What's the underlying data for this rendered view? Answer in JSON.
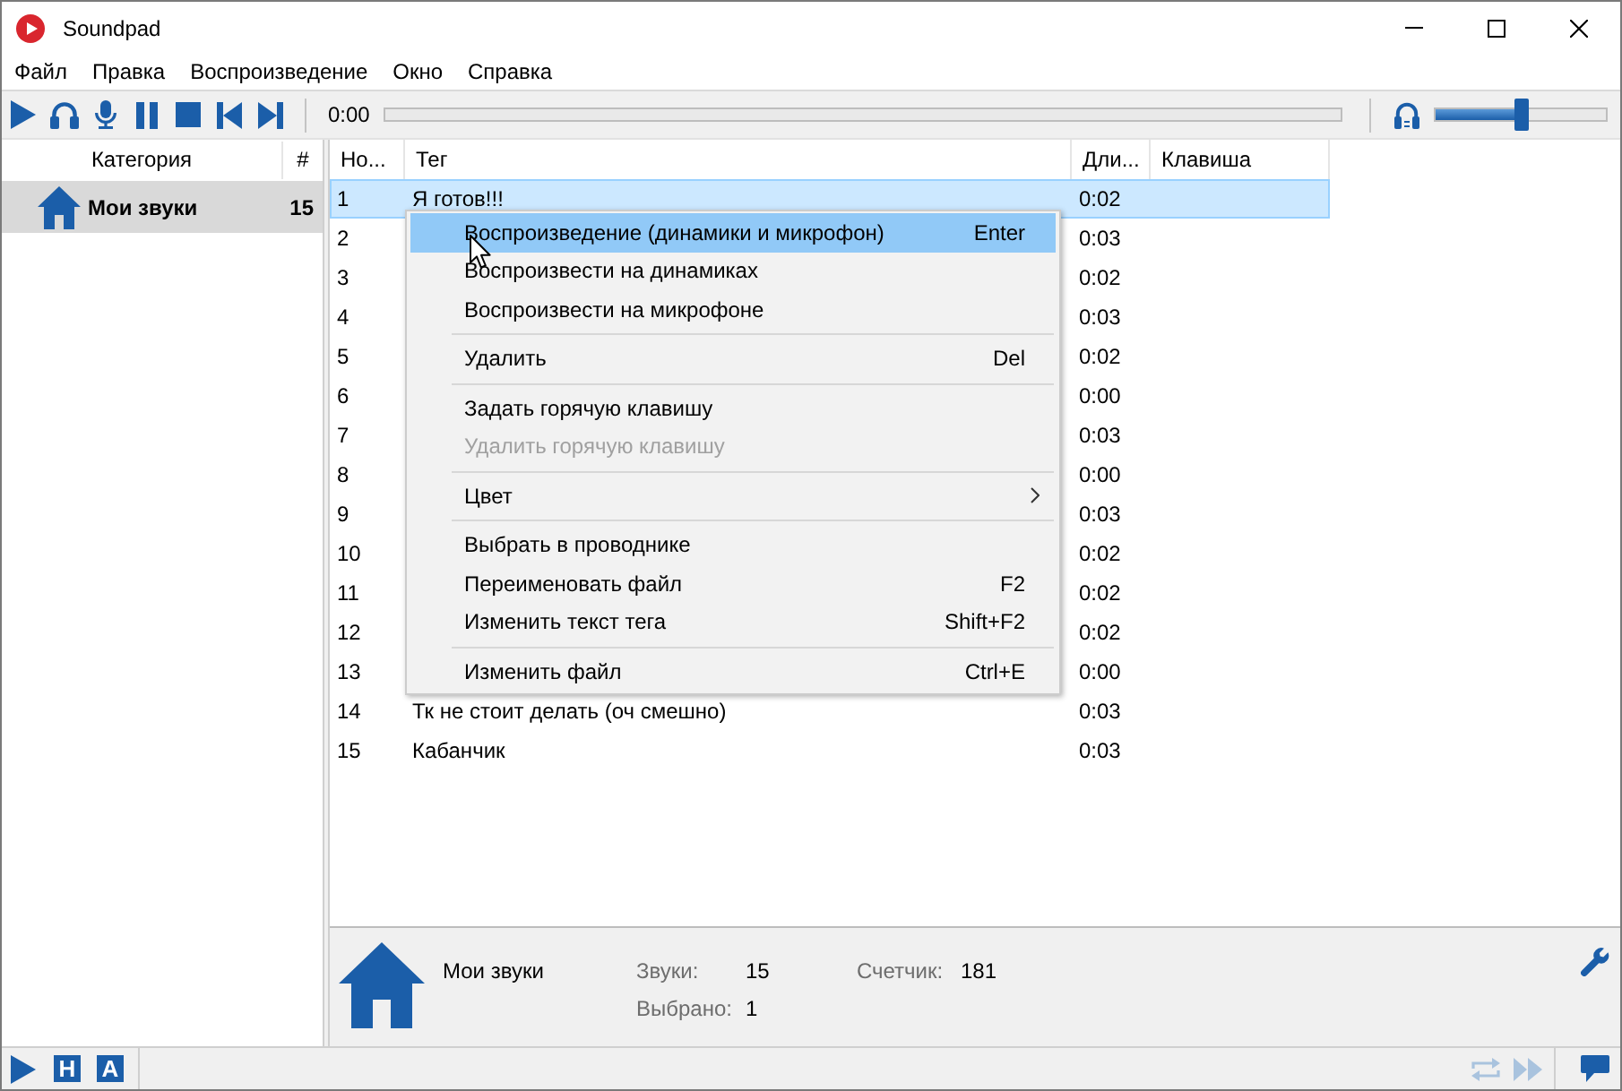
{
  "window": {
    "title": "Soundpad"
  },
  "menu_bar": [
    {
      "label": "Файл"
    },
    {
      "label": "Правка"
    },
    {
      "label": "Воспроизведение"
    },
    {
      "label": "Окно"
    },
    {
      "label": "Справка"
    }
  ],
  "toolbar": {
    "buttons": [
      {
        "kind": "play"
      },
      {
        "kind": "headphones"
      },
      {
        "kind": "microphone"
      },
      {
        "kind": "pause"
      },
      {
        "kind": "stop"
      },
      {
        "kind": "previous"
      },
      {
        "kind": "next"
      }
    ],
    "time": "0:00",
    "volume": {
      "level": 0.5
    }
  },
  "sidebar": {
    "columns": [
      "Категория",
      "#"
    ],
    "items": [
      {
        "label": "Мои звуки",
        "count": "15",
        "selected": true
      }
    ]
  },
  "table": {
    "columns": [
      "Но...",
      "Тег",
      "Дли...",
      "Клавиша"
    ],
    "rows": [
      {
        "number": "1",
        "tag": "Я готов!!!",
        "duration": "0:02",
        "selected": true
      },
      {
        "number": "2",
        "duration": "0:03",
        "selected": false
      },
      {
        "number": "3",
        "duration": "0:02",
        "selected": false
      },
      {
        "number": "4",
        "duration": "0:03",
        "selected": false
      },
      {
        "number": "5",
        "duration": "0:02",
        "selected": false
      },
      {
        "number": "6",
        "duration": "0:00",
        "selected": false
      },
      {
        "number": "7",
        "duration": "0:03",
        "selected": false
      },
      {
        "number": "8",
        "duration": "0:00",
        "selected": false
      },
      {
        "number": "9",
        "duration": "0:03",
        "selected": false
      },
      {
        "number": "10",
        "duration": "0:02",
        "selected": false
      },
      {
        "number": "11",
        "duration": "0:02",
        "selected": false
      },
      {
        "number": "12",
        "duration": "0:02",
        "selected": false
      },
      {
        "number": "13",
        "duration": "0:00",
        "selected": false
      },
      {
        "number": "14",
        "tag": "Тк не стоит делать (оч смешно)",
        "duration": "0:03",
        "selected": false
      },
      {
        "number": "15",
        "tag": "Кабанчик",
        "duration": "0:03",
        "selected": false
      }
    ]
  },
  "context_menu": {
    "items": [
      {
        "kind": "item",
        "label": "Воспроизведение (динамики и микрофон)",
        "shortcut": "Enter",
        "selected": true,
        "disabled": false
      },
      {
        "kind": "item",
        "label": "Воспроизвести на динамиках",
        "selected": false,
        "disabled": false
      },
      {
        "kind": "item",
        "label": "Воспроизвести на микрофоне",
        "selected": false,
        "disabled": false
      },
      {
        "kind": "separator"
      },
      {
        "kind": "item",
        "label": "Удалить",
        "shortcut": "Del",
        "selected": false,
        "disabled": false
      },
      {
        "kind": "separator"
      },
      {
        "kind": "item",
        "label": "Задать горячую клавишу",
        "selected": false,
        "disabled": false
      },
      {
        "kind": "item",
        "label": "Удалить горячую клавишу",
        "selected": false,
        "disabled": true
      },
      {
        "kind": "separator"
      },
      {
        "kind": "submenu",
        "label": "Цвет",
        "selected": false,
        "disabled": false
      },
      {
        "kind": "separator"
      },
      {
        "kind": "item",
        "label": "Выбрать в проводнике",
        "selected": false,
        "disabled": false
      },
      {
        "kind": "item",
        "label": "Переименовать файл",
        "shortcut": "F2",
        "selected": false,
        "disabled": false
      },
      {
        "kind": "item",
        "label": "Изменить текст тега",
        "shortcut": "Shift+F2",
        "selected": false,
        "disabled": false
      },
      {
        "kind": "separator"
      },
      {
        "kind": "item",
        "label": "Изменить файл",
        "shortcut": "Ctrl+E",
        "selected": false,
        "disabled": false
      }
    ]
  },
  "info_panel": {
    "title": "Мои звуки",
    "stats": [
      {
        "label": "Звуки:",
        "value": "15"
      },
      {
        "label": "Счетчик:",
        "value": "181"
      },
      {
        "label": "Выбрано:",
        "value": "1"
      }
    ]
  },
  "status_bar": {
    "left_buttons": [
      {
        "kind": "play"
      },
      {
        "kind": "letter",
        "label": "H"
      },
      {
        "kind": "letter",
        "label": "A"
      }
    ],
    "right_buttons": [
      {
        "kind": "repeat",
        "disabled": true
      },
      {
        "kind": "skip",
        "disabled": true
      },
      {
        "kind": "chat",
        "disabled": false
      }
    ]
  }
}
